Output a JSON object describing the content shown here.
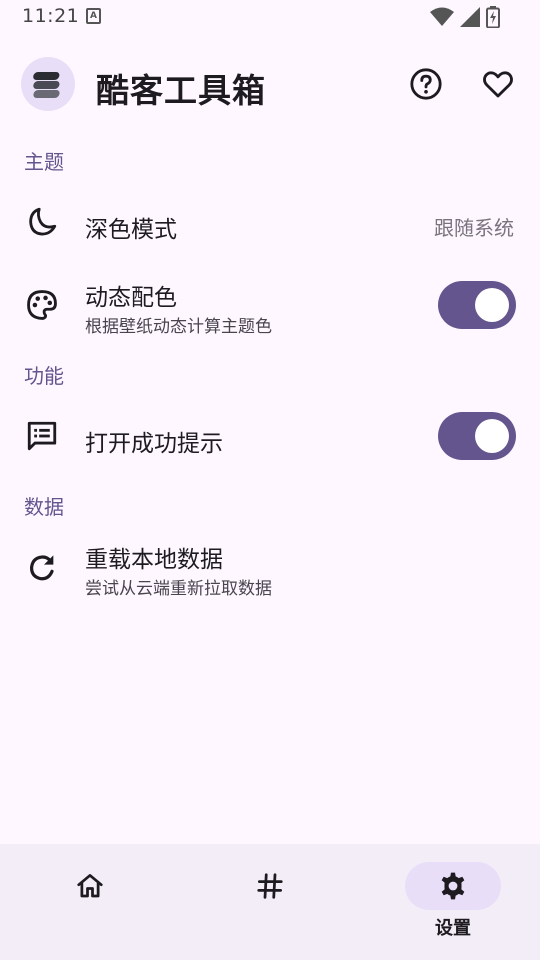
{
  "status_bar": {
    "time": "11:21",
    "notification_icon": "a-icon",
    "icons": [
      "wifi-icon",
      "signal-icon",
      "battery-charging-icon"
    ]
  },
  "header": {
    "title": "酷客工具箱",
    "logo_icon": "stack-layers-icon",
    "help_icon": "help-circle-icon",
    "favorite_icon": "heart-icon"
  },
  "sections": {
    "theme": {
      "title": "主题",
      "dark_mode": {
        "title": "深色模式",
        "value": "跟随系统",
        "icon": "moon-icon"
      },
      "dynamic_color": {
        "title": "动态配色",
        "subtitle": "根据壁纸动态计算主题色",
        "icon": "palette-icon",
        "enabled": true
      }
    },
    "features": {
      "title": "功能",
      "success_tip": {
        "title": "打开成功提示",
        "icon": "message-lines-icon",
        "enabled": true
      }
    },
    "data": {
      "title": "数据",
      "reload": {
        "title": "重载本地数据",
        "subtitle": "尝试从云端重新拉取数据",
        "icon": "refresh-icon"
      }
    }
  },
  "bottom_nav": {
    "items": [
      {
        "icon": "home-icon",
        "label": "",
        "active": false
      },
      {
        "icon": "hash-icon",
        "label": "",
        "active": false
      },
      {
        "icon": "gear-icon",
        "label": "设置",
        "active": true
      }
    ]
  },
  "colors": {
    "accent": "#65558f",
    "accent_container": "#e8def8",
    "background": "#fef7ff",
    "nav_background": "#f3edf7"
  }
}
